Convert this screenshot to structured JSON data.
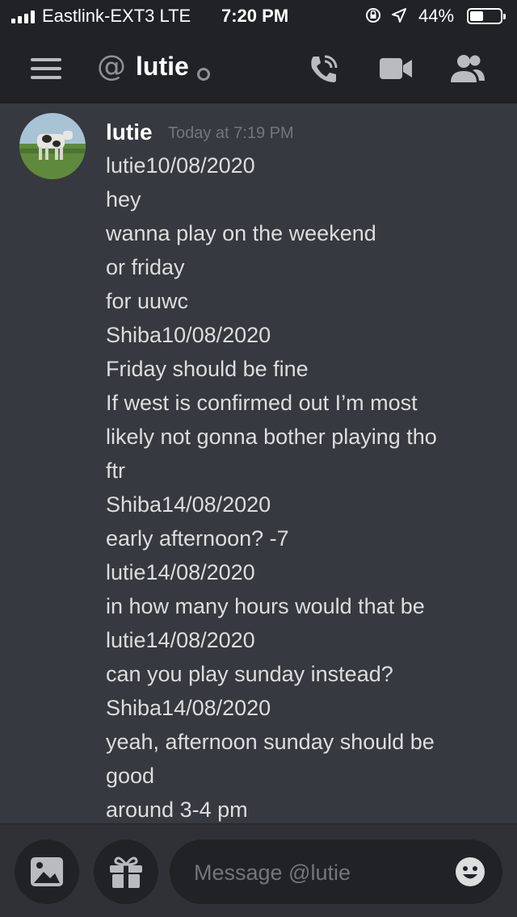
{
  "status_bar": {
    "carrier": "Eastlink-EXT3  LTE",
    "time": "7:20 PM",
    "battery_percent": "44%",
    "battery_level": 0.44
  },
  "header": {
    "at_symbol": "@",
    "channel_name": "lutie",
    "icons": [
      "hamburger-menu-icon",
      "at-icon",
      "presence-icon",
      "voice-call-icon",
      "video-call-icon",
      "members-icon"
    ]
  },
  "message": {
    "author": "lutie",
    "timestamp": "Today at 7:19 PM",
    "lines": [
      "lutie10/08/2020",
      "hey",
      "wanna play on the weekend",
      "or friday",
      "for uuwc",
      "Shiba10/08/2020",
      "Friday should be fine",
      "If west is confirmed out I’m most",
      "likely not gonna bother playing tho",
      "ftr",
      "Shiba14/08/2020",
      "early afternoon? -7",
      "lutie14/08/2020",
      "in how many hours would that be",
      "lutie14/08/2020",
      "can you play sunday instead?",
      "Shiba14/08/2020",
      "yeah, afternoon sunday should be",
      "good",
      "around 3-4 pm"
    ]
  },
  "composer": {
    "placeholder": "Message @lutie",
    "icons": [
      "image-icon",
      "gift-icon",
      "emoji-icon"
    ]
  },
  "colors": {
    "background": "#36393f",
    "header": "#202225",
    "text": "#dcddde",
    "muted": "#72767d"
  }
}
